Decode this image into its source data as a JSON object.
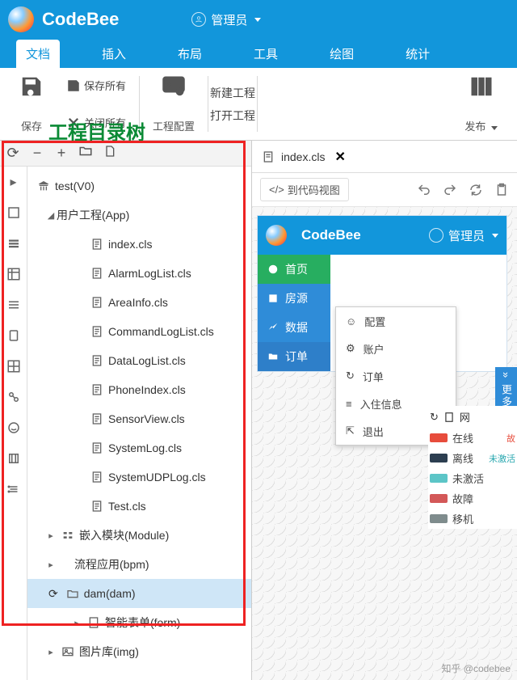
{
  "titlebar": {
    "app": "CodeBee",
    "user": "管理员"
  },
  "menu": {
    "items": [
      "文档",
      "插入",
      "布局",
      "工具",
      "绘图",
      "统计"
    ],
    "active": 0
  },
  "ribbon": {
    "save": "保存",
    "save_all": "保存所有",
    "close_all": "关闭所有",
    "proj_cfg": "工程配置",
    "new_proj": "新建工程",
    "open_proj": "打开工程",
    "publish": "发布"
  },
  "annotation": "工程目录树",
  "tree": {
    "root": "test(V0)",
    "app": "用户工程(App)",
    "files": [
      "index.cls",
      "AlarmLogList.cls",
      "AreaInfo.cls",
      "CommandLogList.cls",
      "DataLogList.cls",
      "PhoneIndex.cls",
      "SensorView.cls",
      "SystemLog.cls",
      "SystemUDPLog.cls",
      "Test.cls"
    ],
    "module": "嵌入模块(Module)",
    "bpm": "流程应用(bpm)",
    "dam": "dam(dam)",
    "form": "智能表单(form)",
    "img": "图片库(img)"
  },
  "tab": {
    "file": "index.cls"
  },
  "subtool": {
    "codeview": "到代码视图"
  },
  "preview": {
    "app": "CodeBee",
    "user": "管理员",
    "nav": [
      "首页",
      "房源",
      "数据",
      "订单"
    ],
    "popup": [
      "配置",
      "账户",
      "订单",
      "入住信息",
      "退出"
    ],
    "more": "更多",
    "legend_title": "网",
    "legend": [
      {
        "label": "在线",
        "color": "#e74c3c"
      },
      {
        "label": "离线",
        "color": "#2c3e50"
      },
      {
        "label": "未激活",
        "color": "#5cc5c7"
      },
      {
        "label": "故障",
        "color": "#d35858"
      },
      {
        "label": "移机",
        "color": "#7f8c8d"
      }
    ],
    "side_note1": "故",
    "side_note2": "未激活"
  },
  "watermark": "知乎 @codebee"
}
